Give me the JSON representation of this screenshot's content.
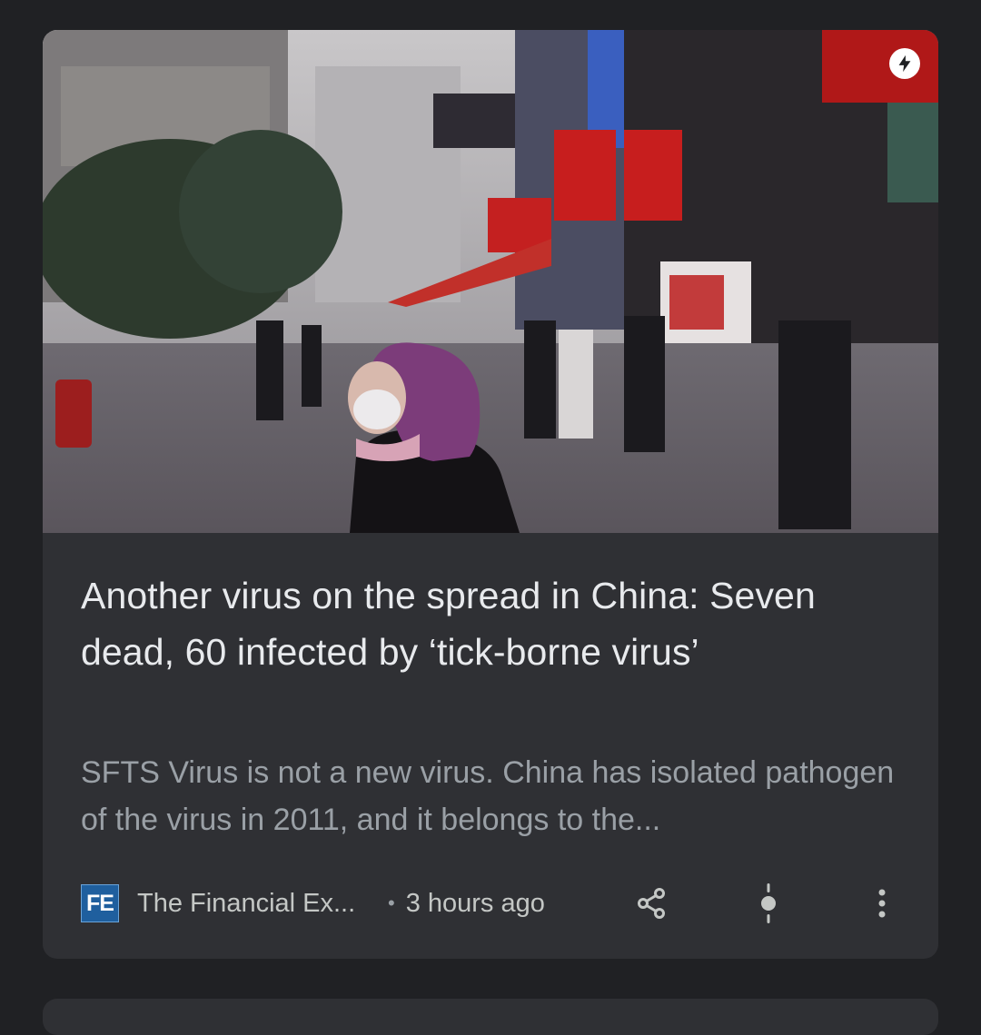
{
  "article": {
    "image_alt": "",
    "title": "Another virus on the spread in China: Seven dead, 60 infected by ‘tick-borne virus’",
    "snippet": "SFTS Virus is not a new virus. China has isolated pathogen of the virus in 2011, and it belongs to the...",
    "publisher_logo_text": "FE",
    "publisher": "The Financial Ex...",
    "separator": "•",
    "time": "3 hours ago"
  },
  "icons": {
    "amp": "lightning-bolt-icon",
    "share": "share-icon",
    "more_like": "more-less-icon",
    "overflow": "more-vertical-icon"
  },
  "colors": {
    "background": "#202124",
    "card": "#2f3034",
    "title": "#e8eaed",
    "snippet": "#9aa0a6"
  }
}
